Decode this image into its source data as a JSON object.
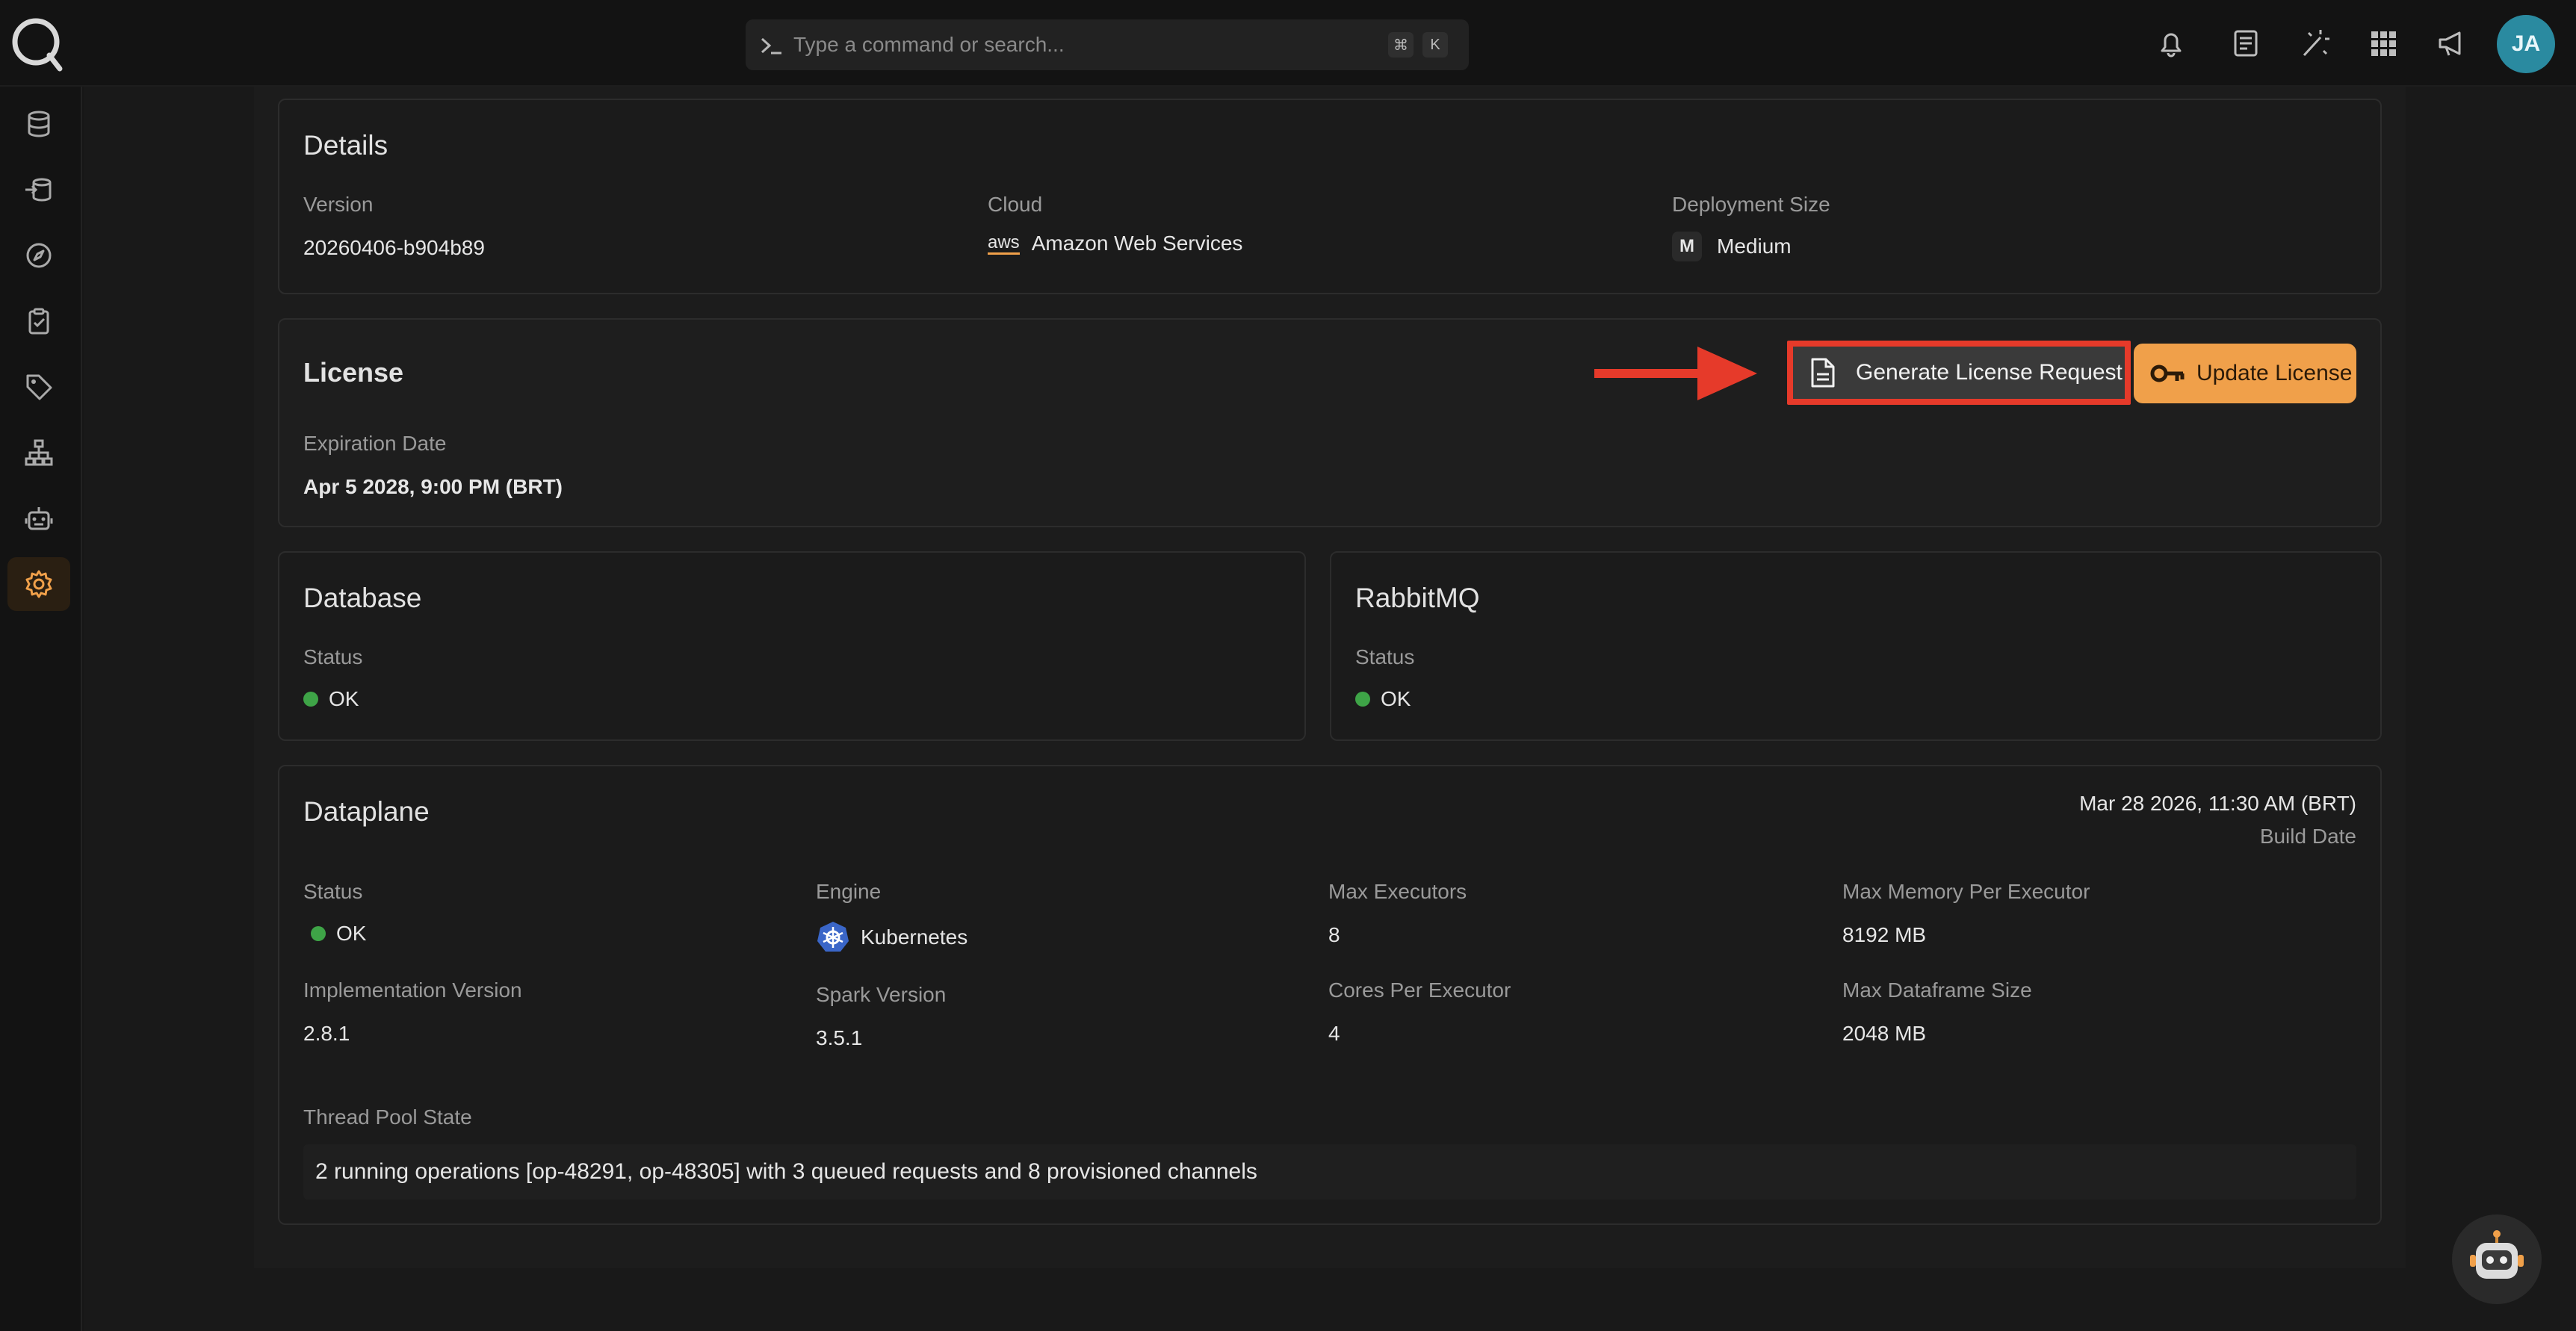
{
  "search": {
    "placeholder": "Type a command or search...",
    "shortcut_mod": "⌘",
    "shortcut_key": "K"
  },
  "user": {
    "initials": "JA"
  },
  "details": {
    "title": "Details",
    "version_label": "Version",
    "version_value": "20260406-b904b89",
    "cloud_label": "Cloud",
    "cloud_value": "Amazon Web Services",
    "cloud_logo_text": "aws",
    "size_label": "Deployment Size",
    "size_badge": "M",
    "size_value": "Medium"
  },
  "license": {
    "title": "License",
    "expiration_label": "Expiration Date",
    "expiration_value": "Apr 5 2028, 9:00 PM (BRT)",
    "generate_button": "Generate License Request",
    "update_button": "Update License"
  },
  "database": {
    "title": "Database",
    "status_label": "Status",
    "status_value": "OK"
  },
  "rabbitmq": {
    "title": "RabbitMQ",
    "status_label": "Status",
    "status_value": "OK"
  },
  "dataplane": {
    "title": "Dataplane",
    "build_date_value": "Mar 28 2026, 11:30 AM (BRT)",
    "build_date_label": "Build Date",
    "status_label": "Status",
    "status_value": "OK",
    "engine_label": "Engine",
    "engine_value": "Kubernetes",
    "max_executors_label": "Max Executors",
    "max_executors_value": "8",
    "max_memory_label": "Max Memory Per Executor",
    "max_memory_value": "8192 MB",
    "impl_version_label": "Implementation Version",
    "impl_version_value": "2.8.1",
    "spark_version_label": "Spark Version",
    "spark_version_value": "3.5.1",
    "cores_label": "Cores Per Executor",
    "cores_value": "4",
    "max_df_label": "Max Dataframe Size",
    "max_df_value": "2048 MB",
    "thread_pool_label": "Thread Pool State",
    "thread_pool_value": "2 running operations [op-48291, op-48305] with 3 queued requests and 8 provisioned channels"
  },
  "colors": {
    "accent": "#f0a04a",
    "ok": "#3ea447",
    "highlight": "#e63a2a",
    "avatar": "#2a8aa0"
  }
}
